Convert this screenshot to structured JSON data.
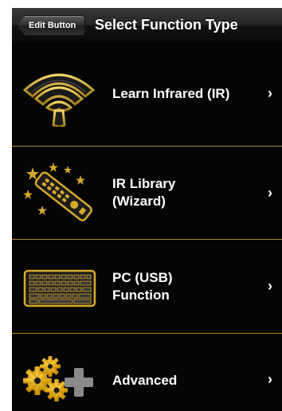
{
  "nav": {
    "back_label": "Edit Button",
    "title": "Select Function Type"
  },
  "menu": {
    "items": [
      {
        "label": "Learn Infrared (IR)",
        "icon": "infrared-waves-icon"
      },
      {
        "label": "IR Library\n(Wizard)",
        "icon": "remote-control-icon"
      },
      {
        "label": "PC (USB)\nFunction",
        "icon": "keyboard-icon"
      },
      {
        "label": "Advanced",
        "icon": "gears-plus-icon"
      }
    ],
    "chevron": "›"
  },
  "colors": {
    "accent_gold": "#d4aa2a",
    "divider": "#a8882a",
    "background": "#050505"
  }
}
